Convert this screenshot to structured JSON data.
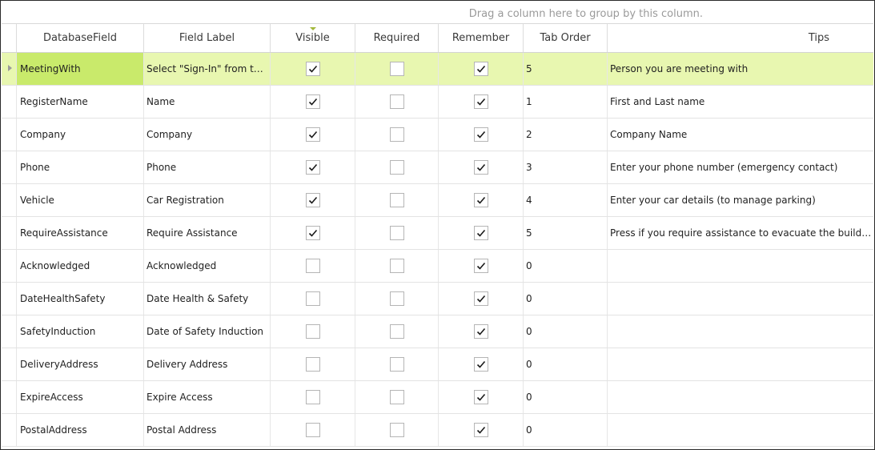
{
  "group_panel": {
    "hint": "Drag a column here to group by this column."
  },
  "columns": {
    "database_field": "DatabaseField",
    "field_label": "Field Label",
    "visible": "Visible",
    "required": "Required",
    "remember": "Remember",
    "tab_order": "Tab Order",
    "tips": "Tips"
  },
  "rows": [
    {
      "field": "MeetingWith",
      "label": "Select \"Sign-In\" from the list",
      "visible": true,
      "required": false,
      "remember": true,
      "tab_order": "5",
      "tips": "Person you are meeting with",
      "selected": true
    },
    {
      "field": "RegisterName",
      "label": "Name",
      "visible": true,
      "required": false,
      "remember": true,
      "tab_order": "1",
      "tips": "First and Last name"
    },
    {
      "field": "Company",
      "label": "Company",
      "visible": true,
      "required": false,
      "remember": true,
      "tab_order": "2",
      "tips": "Company Name"
    },
    {
      "field": "Phone",
      "label": "Phone",
      "visible": true,
      "required": false,
      "remember": true,
      "tab_order": "3",
      "tips": "Enter your phone number (emergency contact)"
    },
    {
      "field": "Vehicle",
      "label": "Car Registration",
      "visible": true,
      "required": false,
      "remember": true,
      "tab_order": "4",
      "tips": "Enter your car details (to manage parking)"
    },
    {
      "field": "RequireAssistance",
      "label": "Require Assistance",
      "visible": true,
      "required": false,
      "remember": true,
      "tab_order": "5",
      "tips": " Press if you require assistance to evacuate the building"
    },
    {
      "field": "Acknowledged",
      "label": "Acknowledged",
      "visible": false,
      "required": false,
      "remember": true,
      "tab_order": "0",
      "tips": ""
    },
    {
      "field": "DateHealthSafety",
      "label": "Date Health & Safety",
      "visible": false,
      "required": false,
      "remember": true,
      "tab_order": "0",
      "tips": ""
    },
    {
      "field": "SafetyInduction",
      "label": "Date of Safety Induction",
      "visible": false,
      "required": false,
      "remember": true,
      "tab_order": "0",
      "tips": ""
    },
    {
      "field": "DeliveryAddress",
      "label": "Delivery Address",
      "visible": false,
      "required": false,
      "remember": true,
      "tab_order": "0",
      "tips": ""
    },
    {
      "field": "ExpireAccess",
      "label": "Expire Access",
      "visible": false,
      "required": false,
      "remember": true,
      "tab_order": "0",
      "tips": ""
    },
    {
      "field": "PostalAddress",
      "label": "Postal Address",
      "visible": false,
      "required": false,
      "remember": true,
      "tab_order": "0",
      "tips": ""
    }
  ]
}
